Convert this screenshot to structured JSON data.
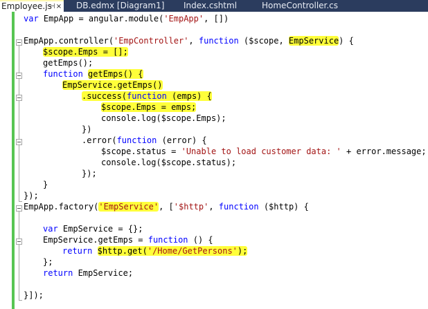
{
  "tabs": [
    {
      "label": "Employee.js",
      "active": true
    },
    {
      "label": "DB.edmx [Diagram1]",
      "active": false
    },
    {
      "label": "Index.cshtml",
      "active": false
    },
    {
      "label": "HomeController.cs",
      "active": false
    }
  ],
  "tab_icons": {
    "pin": "⊣",
    "close": "×"
  },
  "colors": {
    "keyword": "#0000ff",
    "string": "#a31515",
    "highlight": "#ffff3a",
    "margin_bar": "#57c553",
    "tabbar": "#2b3c5e"
  },
  "code": {
    "l1": {
      "a": "var",
      "b": " EmpApp = angular.module(",
      "c": "'EmpApp'",
      "d": ", [])"
    },
    "l3": {
      "a": "EmpApp.controller(",
      "b": "'EmpController'",
      "c": ", ",
      "d": "function",
      "e": " ($scope, ",
      "f": "EmpService",
      "g": ") {"
    },
    "l4": {
      "a": "$scope.Emps = [];"
    },
    "l5": {
      "a": "getEmps();"
    },
    "l6": {
      "a": "function",
      "b": " ",
      "c": "getEmps() {"
    },
    "l7": {
      "a": "EmpService.getEmps()"
    },
    "l8": {
      "a": ".success(",
      "b": "function",
      "c": " (emps) {"
    },
    "l9": {
      "a": "$scope.Emps = emps;"
    },
    "l10": {
      "a": "console.log($scope.Emps);"
    },
    "l11": {
      "a": "})"
    },
    "l12": {
      "a": ".error(",
      "b": "function",
      "c": " (error) {"
    },
    "l13": {
      "a": "$scope.status = ",
      "b": "'Unable to load customer data: '",
      "c": " + error.message;"
    },
    "l14": {
      "a": "console.log($scope.status);"
    },
    "l15": {
      "a": "});"
    },
    "l16": {
      "a": "}"
    },
    "l17": {
      "a": "});"
    },
    "l18": {
      "a": "EmpApp.factory(",
      "b": "'EmpService'",
      "c": ", [",
      "d": "'$http'",
      "e": ", ",
      "f": "function",
      "g": " ($http) {"
    },
    "l20": {
      "a": "var",
      "b": " EmpService = {};"
    },
    "l21": {
      "a": "EmpService.getEmps = ",
      "b": "function",
      "c": " () {"
    },
    "l22": {
      "a": "return",
      "b": " ",
      "c": "$http.get(",
      "d": "'/Home/GetPersons'",
      "e": ");"
    },
    "l23": {
      "a": "};"
    },
    "l24": {
      "a": "return",
      "b": " EmpService;"
    },
    "l26": {
      "a": "}]);"
    }
  }
}
